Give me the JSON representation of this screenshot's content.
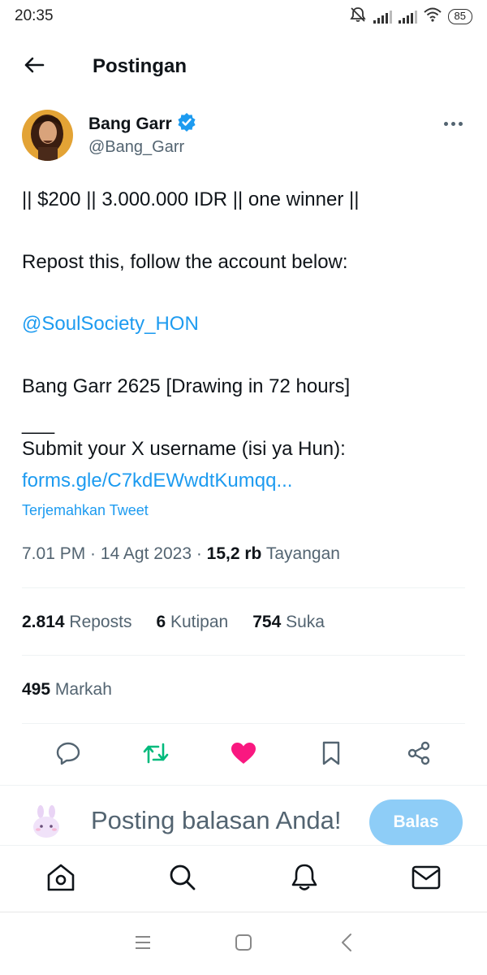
{
  "status_bar": {
    "time": "20:35",
    "battery": "85",
    "icons": [
      "mute-icon",
      "signal-icon",
      "signal-icon",
      "wifi-icon",
      "battery-icon"
    ]
  },
  "header": {
    "title": "Postingan",
    "back_icon": "back-arrow-icon"
  },
  "author": {
    "name": "Bang Garr",
    "handle": "@Bang_Garr",
    "verified": true,
    "verified_color": "#1d9bf0"
  },
  "tweet": {
    "line1": "|| $200 || 3.000.000 IDR || one winner ||",
    "line2": "Repost this, follow the account below:",
    "mention": "@SoulSociety_HON",
    "line3": "Bang Garr 2625 [Drawing in 72 hours]",
    "separator": "___",
    "line4": "Submit your X username (isi ya Hun):",
    "link": "forms.gle/C7kdEWwdtKumqq...",
    "translate": "Terjemahkan Tweet"
  },
  "meta": {
    "time": "7.01 PM",
    "date": "14 Agt 2023",
    "views_count": "15,2 rb",
    "views_label": "Tayangan"
  },
  "stats": {
    "reposts_count": "2.814",
    "reposts_label": "Reposts",
    "quotes_count": "6",
    "quotes_label": "Kutipan",
    "likes_count": "754",
    "likes_label": "Suka",
    "bookmarks_count": "495",
    "bookmarks_label": "Markah"
  },
  "actions": {
    "icons": [
      "reply-icon",
      "repost-icon",
      "like-icon",
      "bookmark-icon",
      "share-icon"
    ],
    "repost_color": "#00ba7c",
    "like_color": "#f91880"
  },
  "reply_bar": {
    "placeholder": "Posting balasan Anda!",
    "button": "Balas",
    "button_color": "#8ecdf7"
  },
  "bottom_nav": [
    "home-icon",
    "search-icon",
    "notifications-icon",
    "messages-icon"
  ],
  "system_nav": [
    "menu-icon",
    "home-square-icon",
    "back-chevron-icon"
  ]
}
